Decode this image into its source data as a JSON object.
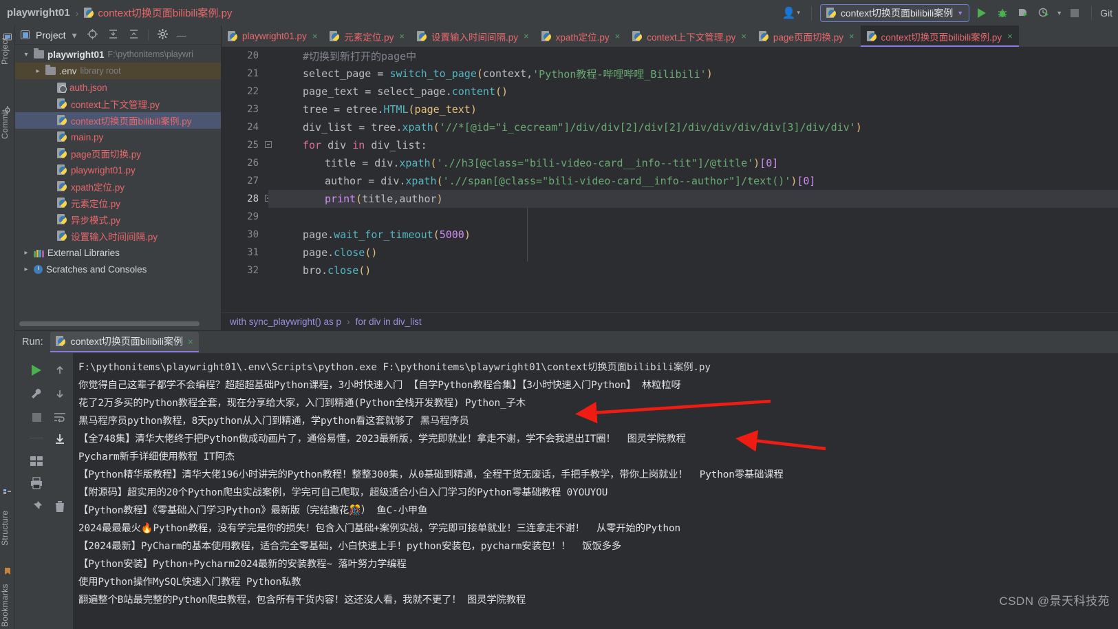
{
  "window": {
    "breadcrumb_project": "playwright01",
    "breadcrumb_separator": "›",
    "breadcrumb_file": "context切换页面bilibili案例.py",
    "run_config_name": "context切换页面bilibili案例",
    "git_label": "Git"
  },
  "left_toolbar": {
    "project": "Project",
    "commit": "Commit",
    "structure": "Structure",
    "bookmarks": "Bookmarks"
  },
  "project_panel": {
    "title": "Project",
    "tree": [
      {
        "indent": 0,
        "arrow": "open",
        "icon": "folder",
        "label": "playwright01",
        "bold": true,
        "sub": "F:\\pythonitems\\playwri",
        "state": "normal"
      },
      {
        "indent": 1,
        "arrow": "closed",
        "icon": "folder",
        "label": ".env",
        "bold": false,
        "sub": "library root",
        "state": "highlight"
      },
      {
        "indent": 2,
        "arrow": "none",
        "icon": "json",
        "label": "auth.json",
        "py": true,
        "sub": "",
        "state": "normal"
      },
      {
        "indent": 2,
        "arrow": "none",
        "icon": "python",
        "label": "context上下文管理.py",
        "py": true,
        "sub": "",
        "state": "normal"
      },
      {
        "indent": 2,
        "arrow": "none",
        "icon": "python",
        "label": "context切换页面bilibili案例.py",
        "py": true,
        "sub": "",
        "state": "selected"
      },
      {
        "indent": 2,
        "arrow": "none",
        "icon": "python",
        "label": "main.py",
        "py": true,
        "sub": "",
        "state": "normal"
      },
      {
        "indent": 2,
        "arrow": "none",
        "icon": "python",
        "label": "page页面切换.py",
        "py": true,
        "sub": "",
        "state": "normal"
      },
      {
        "indent": 2,
        "arrow": "none",
        "icon": "python",
        "label": "playwright01.py",
        "py": true,
        "sub": "",
        "state": "normal"
      },
      {
        "indent": 2,
        "arrow": "none",
        "icon": "python",
        "label": "xpath定位.py",
        "py": true,
        "sub": "",
        "state": "normal"
      },
      {
        "indent": 2,
        "arrow": "none",
        "icon": "python",
        "label": "元素定位.py",
        "py": true,
        "sub": "",
        "state": "normal"
      },
      {
        "indent": 2,
        "arrow": "none",
        "icon": "python",
        "label": "异步模式.py",
        "py": true,
        "sub": "",
        "state": "normal"
      },
      {
        "indent": 2,
        "arrow": "none",
        "icon": "python",
        "label": "设置输入时间间隔.py",
        "py": true,
        "sub": "",
        "state": "normal"
      },
      {
        "indent": 0,
        "arrow": "closed",
        "icon": "library",
        "label": "External Libraries",
        "bold": false,
        "sub": "",
        "state": "normal"
      },
      {
        "indent": 0,
        "arrow": "closed",
        "icon": "clock",
        "label": "Scratches and Consoles",
        "bold": false,
        "sub": "",
        "state": "normal"
      }
    ]
  },
  "editor": {
    "tabs": [
      {
        "label": "playwright01.py",
        "active": false
      },
      {
        "label": "元素定位.py",
        "active": false
      },
      {
        "label": "设置输入时间间隔.py",
        "active": false
      },
      {
        "label": "xpath定位.py",
        "active": false
      },
      {
        "label": "context上下文管理.py",
        "active": false
      },
      {
        "label": "page页面切换.py",
        "active": false
      },
      {
        "label": "context切换页面bilibili案例.py",
        "active": true
      }
    ],
    "close_glyph": "×",
    "lines": [
      {
        "no": "20",
        "current": false
      },
      {
        "no": "21",
        "current": false
      },
      {
        "no": "22",
        "current": false
      },
      {
        "no": "23",
        "current": false
      },
      {
        "no": "24",
        "current": false
      },
      {
        "no": "25",
        "current": false
      },
      {
        "no": "26",
        "current": false
      },
      {
        "no": "27",
        "current": false
      },
      {
        "no": "28",
        "current": true
      },
      {
        "no": "29",
        "current": false
      },
      {
        "no": "30",
        "current": false
      },
      {
        "no": "31",
        "current": false
      },
      {
        "no": "32",
        "current": false
      }
    ],
    "code": {
      "l20": "#切换到新打开的page中",
      "l21_a": "select_page ",
      "l21_b": "= ",
      "l21_c": "switch_to_page",
      "l21_d": "(",
      "l21_e": "context,",
      "l21_f": "'Python教程-哔哩哔哩_Bilibili'",
      "l21_g": ")",
      "l22_a": "page_text ",
      "l22_b": "= ",
      "l22_c": "select_page.",
      "l22_d": "content",
      "l22_e": "()",
      "l23_a": "tree ",
      "l23_b": "= ",
      "l23_c": "etree.",
      "l23_d": "HTML",
      "l23_e": "(page_text)",
      "l24_a": "div_list ",
      "l24_b": "= ",
      "l24_c": "tree.",
      "l24_d": "xpath",
      "l24_e": "(",
      "l24_f": "'//*[@id=\"i_cecream\"]/div/div[2]/div[2]/div/div/div/div[3]/div/div'",
      "l24_g": ")",
      "l25_a": "for ",
      "l25_b": "div ",
      "l25_c": "in ",
      "l25_d": "div_list:",
      "l26_a": "title ",
      "l26_b": "= ",
      "l26_c": "div.",
      "l26_d": "xpath",
      "l26_e": "(",
      "l26_f": "'.//h3[@class=\"bili-video-card__info--tit\"]/@title'",
      "l26_g": ")",
      "l26_h": "[",
      "l26_i": "0",
      "l26_j": "]",
      "l27_a": "author ",
      "l27_b": "= ",
      "l27_c": "div.",
      "l27_d": "xpath",
      "l27_e": "(",
      "l27_f": "'.//span[@class=\"bili-video-card__info--author\"]/text()'",
      "l27_g": ")",
      "l27_h": "[",
      "l27_i": "0",
      "l27_j": "]",
      "l28_a": "print",
      "l28_b": "(",
      "l28_c": "title,author",
      "l28_d": ")",
      "l30_a": "page.",
      "l30_b": "wait_for_timeout",
      "l30_c": "(",
      "l30_d": "5000",
      "l30_e": ")",
      "l31_a": "page.",
      "l31_b": "close",
      "l31_c": "()",
      "l32_a": "bro.",
      "l32_b": "close",
      "l32_c": "()"
    },
    "breadcrumbs": [
      "with sync_playwright() as p",
      "for div in div_list"
    ],
    "breadcrumb_sep": "›"
  },
  "run_window": {
    "label": "Run:",
    "tab_label": "context切换页面bilibili案例",
    "close_glyph": "×",
    "console_lines": [
      "F:\\pythonitems\\playwright01\\.env\\Scripts\\python.exe F:\\pythonitems\\playwright01\\context切换页面bilibili案例.py",
      "你觉得自己这辈子都学不会编程？超超超基础Python课程，3小时快速入门 【自学Python教程合集】【3小时快速入门Python】 林粒粒呀",
      "花了2万多买的Python教程全套，现在分享给大家，入门到精通(Python全栈开发教程) Python_子木",
      "黑马程序员python教程，8天python从入门到精通，学python看这套就够了 黑马程序员",
      "【全748集】清华大佬终于把Python做成动画片了，通俗易懂，2023最新版，学完即就业！拿走不谢，学不会我退出IT圈！  图灵学院教程",
      "Pycharm新手详细使用教程 IT阿杰",
      "【Python精华版教程】清华大佬196小时讲完的Python教程！整整300集，从0基础到精通，全程干货无废话，手把手教学，带你上岗就业！  Python零基础课程",
      "【附源码】超实用的20个Python爬虫实战案例，学完可自己爬取，超级适合小白入门学习的Python零基础教程 0YOUYOU",
      "【Python教程】《零基础入门学习Python》最新版（完结撒花🎊） 鱼C-小甲鱼",
      "2024最最最火🔥Python教程，没有学完是你的损失！包含入门基础+案例实战，学完即可接单就业！三连拿走不谢！  从零开始的Python",
      "【2024最新】PyCharm的基本使用教程，适合完全零基础，小白快速上手！python安装包，pycharm安装包！！  饭饭多多",
      "【Python安装】Python+Pycharm2024最新的安装教程~ 落叶努力学编程",
      "使用Python操作MySQL快速入门教程 Python私教",
      "翻遍整个B站最完整的Python爬虫教程，包含所有干货内容！这还没人看，我就不更了！ 图灵学院教程"
    ]
  },
  "watermark": "CSDN @景天科技苑",
  "colors": {
    "accent_purple": "#8d7ae0",
    "run_green": "#4caf50",
    "file_red": "#e8686b",
    "selection_blue": "#4b5772",
    "annotation_red": "#ee1c13"
  }
}
